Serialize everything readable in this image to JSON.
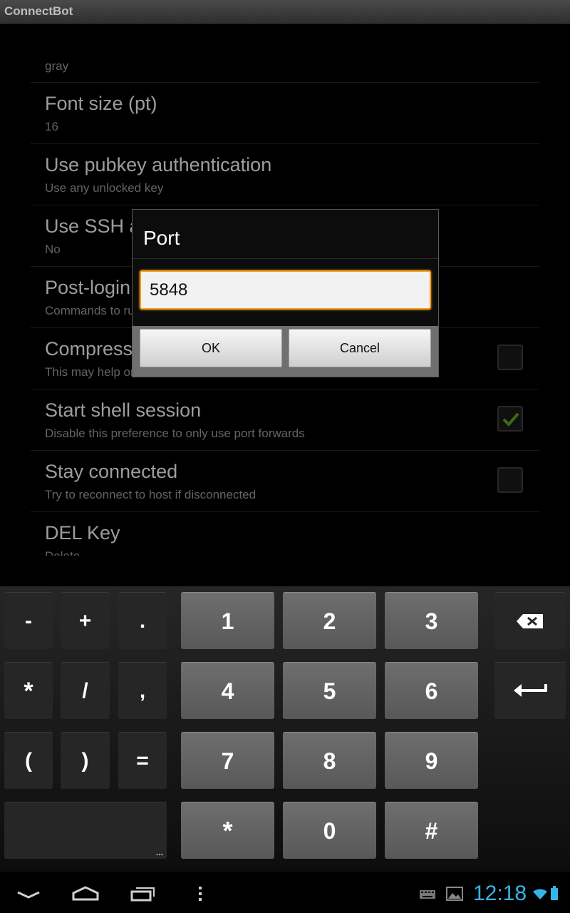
{
  "app": {
    "title": "ConnectBot"
  },
  "prefs": [
    {
      "title": "",
      "summary": "gray"
    },
    {
      "title": "Font size (pt)",
      "summary": "16"
    },
    {
      "title": "Use pubkey authentication",
      "summary": "Use any unlocked key"
    },
    {
      "title": "Use SSH auth agent",
      "summary": "No"
    },
    {
      "title": "Post-login automation",
      "summary": "Commands to run on remote server once authenticated"
    },
    {
      "title": "Compression",
      "summary": "This may help on slow networks",
      "checked": false
    },
    {
      "title": "Start shell session",
      "summary": "Disable this preference to only use port forwards",
      "checked": true
    },
    {
      "title": "Stay connected",
      "summary": "Try to reconnect to host if disconnected",
      "checked": false
    },
    {
      "title": "DEL Key",
      "summary": "Delete"
    }
  ],
  "dialog": {
    "title": "Port",
    "value": "5848",
    "ok_label": "OK",
    "cancel_label": "Cancel"
  },
  "keyboard": {
    "symbols_row1": [
      "-",
      "+",
      "."
    ],
    "symbols_row2": [
      "*",
      "/",
      ","
    ],
    "symbols_row3": [
      "(",
      ")",
      "="
    ],
    "digits_row1": [
      "1",
      "2",
      "3"
    ],
    "digits_row2": [
      "4",
      "5",
      "6"
    ],
    "digits_row3": [
      "7",
      "8",
      "9"
    ],
    "digits_row4": [
      "*",
      "0",
      "#"
    ],
    "more_label": "...",
    "icons": {
      "delete": "backspace-icon",
      "enter": "enter-icon"
    }
  },
  "status": {
    "time": "12:18",
    "accent_color": "#33b5e5",
    "icons": [
      "keyboard-icon",
      "gallery-icon",
      "wifi-icon",
      "battery-icon"
    ]
  },
  "nav": {
    "icons": [
      "back-icon",
      "home-icon",
      "recent-apps-icon",
      "menu-icon"
    ]
  }
}
